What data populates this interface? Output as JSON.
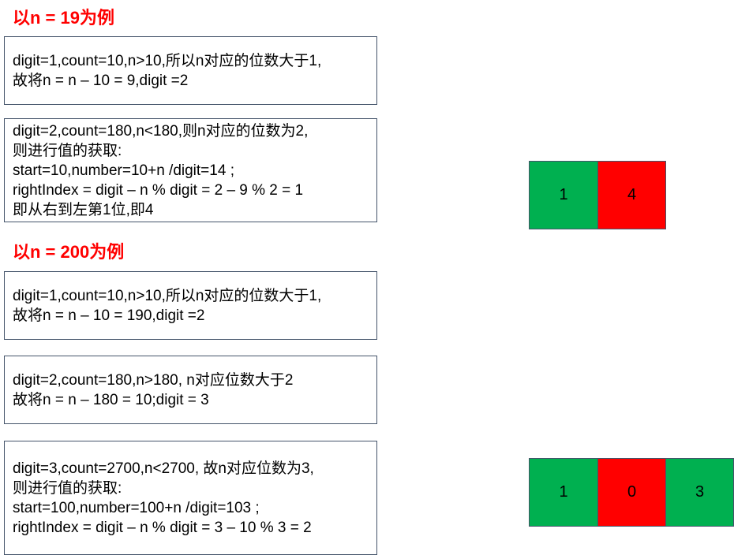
{
  "headings": [
    "以n = 19为例",
    "以n = 200为例"
  ],
  "boxes": [
    [
      "digit=1,count=10,n>10,所以n对应的位数大于1,",
      "故将n = n – 10 = 9,digit =2"
    ],
    [
      "digit=2,count=180,n<180,则n对应的位数为2,",
      "则进行值的获取:",
      "start=10,number=10+n /digit=14 ;",
      "rightIndex = digit – n % digit = 2 – 9 % 2 = 1",
      "即从右到左第1位,即4"
    ],
    [
      "digit=1,count=10,n>10,所以n对应的位数大于1,",
      "故将n = n – 10 = 190,digit =2"
    ],
    [
      "digit=2,count=180,n>180, n对应位数大于2",
      "故将n = n – 180 = 10;digit = 3"
    ],
    [
      "digit=3,count=2700,n<2700, 故n对应位数为3,",
      "则进行值的获取:",
      "start=100,number=100+n /digit=103 ;",
      "rightIndex = digit – n % digit = 3 – 10 % 3 = 2"
    ]
  ],
  "cells_n19": [
    {
      "text": "1",
      "color": "#00b050"
    },
    {
      "text": "4",
      "color": "#ff0000"
    }
  ],
  "cells_n200": [
    {
      "text": "1",
      "color": "#00b050"
    },
    {
      "text": "0",
      "color": "#ff0000"
    },
    {
      "text": "3",
      "color": "#00b050"
    }
  ],
  "colors": {
    "heading": "#ff0000",
    "green": "#00b050",
    "red": "#ff0000",
    "border": "#44546a"
  }
}
